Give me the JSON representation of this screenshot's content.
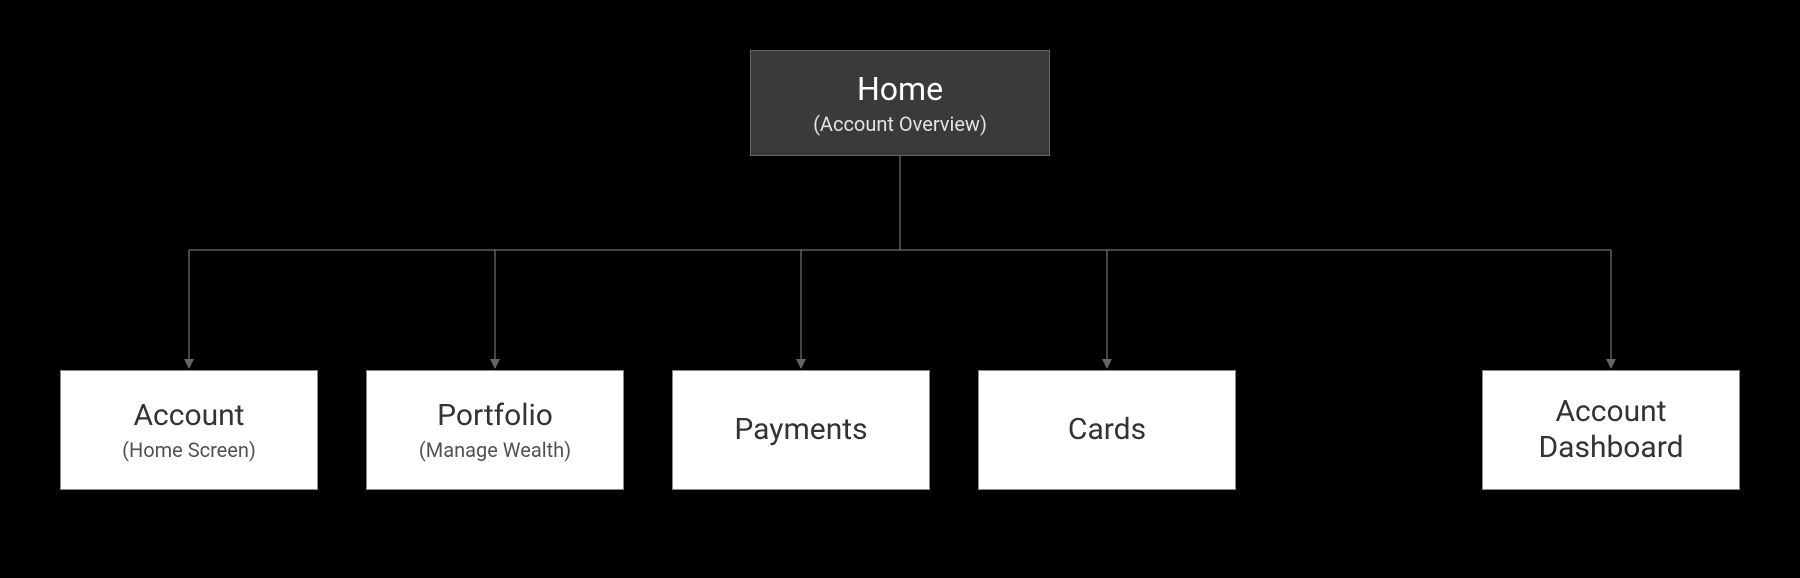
{
  "root": {
    "title": "Home",
    "subtitle": "(Account Overview)"
  },
  "children": [
    {
      "title": "Account",
      "subtitle": "(Home Screen)"
    },
    {
      "title": "Portfolio",
      "subtitle": "(Manage Wealth)"
    },
    {
      "title": "Payments",
      "subtitle": ""
    },
    {
      "title": "Cards",
      "subtitle": ""
    },
    {
      "title": "Account Dashboard",
      "subtitle": ""
    }
  ]
}
